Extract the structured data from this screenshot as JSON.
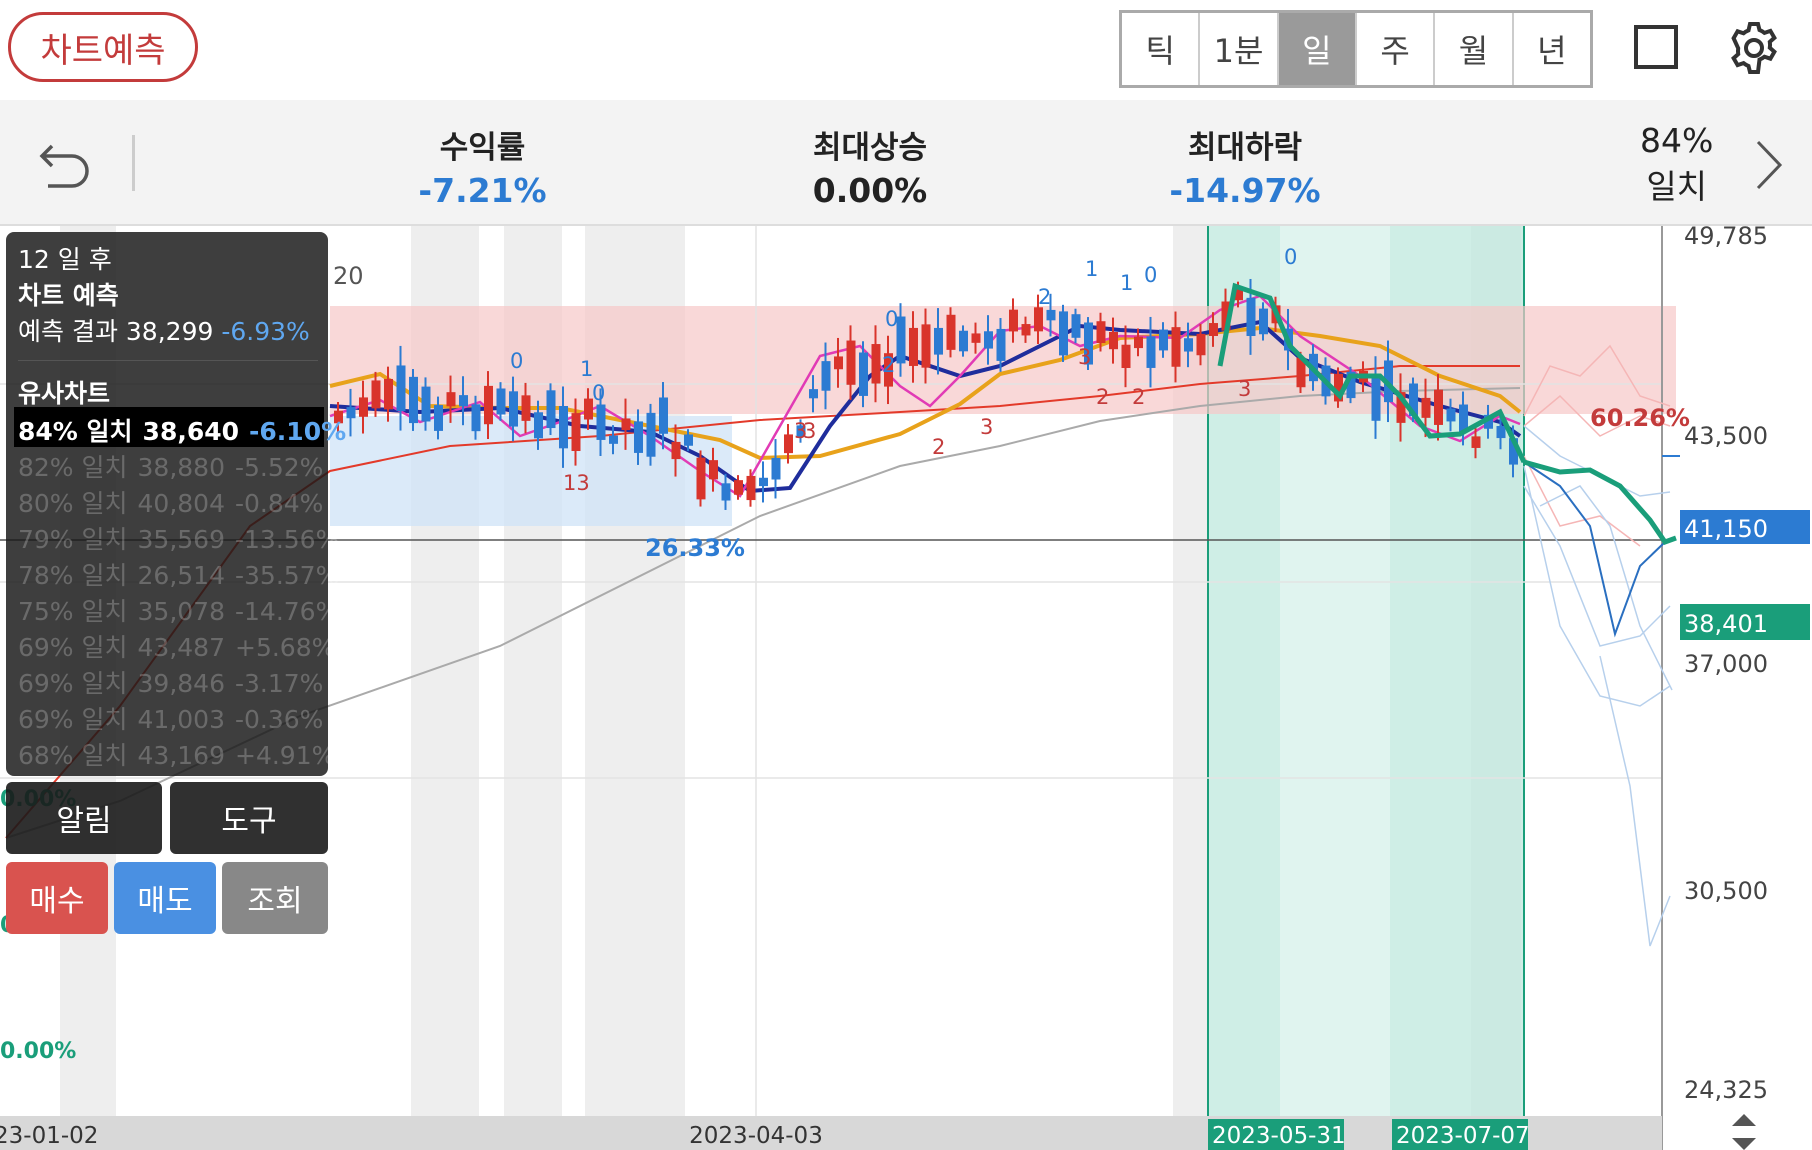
{
  "toolbar": {
    "predict_label": "차트예측",
    "periods": [
      "틱",
      "1분",
      "일",
      "주",
      "월",
      "년"
    ],
    "active_period": "일"
  },
  "stats": {
    "return_label": "수익률",
    "return_value": "-7.21%",
    "max_rise_label": "최대상승",
    "max_rise_value": "0.00%",
    "max_drop_label": "최대하락",
    "max_drop_value": "-14.97%",
    "match_value": "84%",
    "match_label": "일치"
  },
  "panel": {
    "after_days": "12 일 후",
    "predict_title": "차트 예측",
    "result_label": "예측 결과",
    "result_price": "38,299",
    "result_pct": "-6.93%",
    "similar_title": "유사차트",
    "similar": [
      {
        "match": "84% 일치",
        "price": "38,640",
        "pct": "-6.10%"
      },
      {
        "match": "82% 일치",
        "price": "38,880",
        "pct": "-5.52%"
      },
      {
        "match": "80% 일치",
        "price": "40,804",
        "pct": "-0.84%"
      },
      {
        "match": "79% 일치",
        "price": "35,569",
        "pct": "-13.56%"
      },
      {
        "match": "78% 일치",
        "price": "26,514",
        "pct": "-35.57%"
      },
      {
        "match": "75% 일치",
        "price": "35,078",
        "pct": "-14.76%"
      },
      {
        "match": "69% 일치",
        "price": "43,487",
        "pct": "+5.68%"
      },
      {
        "match": "69% 일치",
        "price": "39,846",
        "pct": "-3.17%"
      },
      {
        "match": "69% 일치",
        "price": "41,003",
        "pct": "-0.36%"
      },
      {
        "match": "68% 일치",
        "price": "43,169",
        "pct": "+4.91%"
      }
    ],
    "alarm_label": "알림",
    "tools_label": "도구",
    "buy_label": "매수",
    "sell_label": "매도",
    "view_label": "조회"
  },
  "chart_data": {
    "type": "candlestick",
    "y_ticks": [
      "49,785",
      "43,500",
      "37,000",
      "30,500",
      "24,325"
    ],
    "x_ticks": [
      "23-01-02",
      "2023-04-03",
      "2023-05-31",
      "2023-07-07"
    ],
    "current_price_label": "41,150",
    "predicted_price_label": "38,401",
    "zone_pct_label": "60.26%",
    "zone_pct_blue": "26.33%",
    "left_pct_labels": [
      "0.00%",
      "0.00%",
      "0.00%"
    ],
    "ma_legend": "20",
    "signal_labels": [
      "0",
      "1",
      "0",
      "13",
      "2",
      "0",
      "3",
      "1",
      "1",
      "0",
      "2",
      "3",
      "2",
      "3",
      "2",
      "2",
      "0",
      "3",
      "3"
    ],
    "colors": {
      "up": "#d9342b",
      "down": "#2c7bd2",
      "ma5": "#e13bb5",
      "ma20": "#1f2d9c",
      "ma60": "#e8a21b",
      "ma120": "#e33a2a",
      "ma240": "#aaaaaa",
      "prediction": "#1a9e7a"
    }
  }
}
